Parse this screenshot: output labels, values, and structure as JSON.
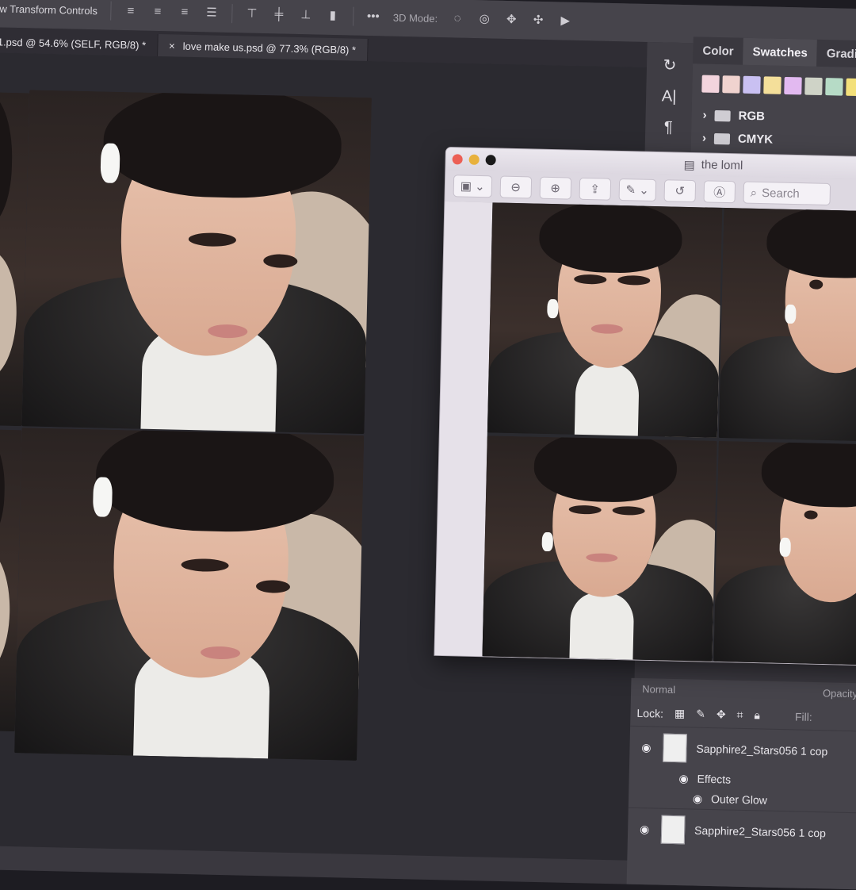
{
  "toolbar": {
    "transform_label": "w Transform Controls",
    "mode_label": "3D Mode:",
    "more_label": "•••"
  },
  "tabs": [
    {
      "label": "-1.psd @ 54.6% (SELF, RGB/8) *",
      "active": false
    },
    {
      "label": "love make us.psd @ 77.3% (RGB/8) *",
      "active": true,
      "close": "×"
    }
  ],
  "right_panel": {
    "collapse_glyph": "«",
    "tabs": [
      "Color",
      "Swatches",
      "Gradi"
    ],
    "active_tab": "Swatches",
    "swatches": [
      "#f3d4dd",
      "#f0d3cf",
      "#c9c0f2",
      "#f4df9a",
      "#e2b9f0",
      "#cfd3c7",
      "#b6dbc6",
      "#f3e07a"
    ],
    "folders": [
      "RGB",
      "CMYK"
    ]
  },
  "layers": {
    "mode": "Normal",
    "opacity_label": "Opacity",
    "lock_label": "Lock:",
    "fill_label": "Fill:",
    "items": [
      {
        "name": "Sapphire2_Stars056 1 cop",
        "effects": "Effects",
        "effect": "Outer Glow"
      },
      {
        "name": "Sapphire2_Stars056 1 cop"
      }
    ]
  },
  "preview": {
    "title": "the loml",
    "search_placeholder": "Search",
    "traffic": [
      "#ec5f55",
      "#e8b13c",
      "#1a1a1a"
    ]
  },
  "colors": {
    "ps_bg": "#2b2a30",
    "panel": "#46444b",
    "preview_chrome": "#ddd8e1"
  }
}
